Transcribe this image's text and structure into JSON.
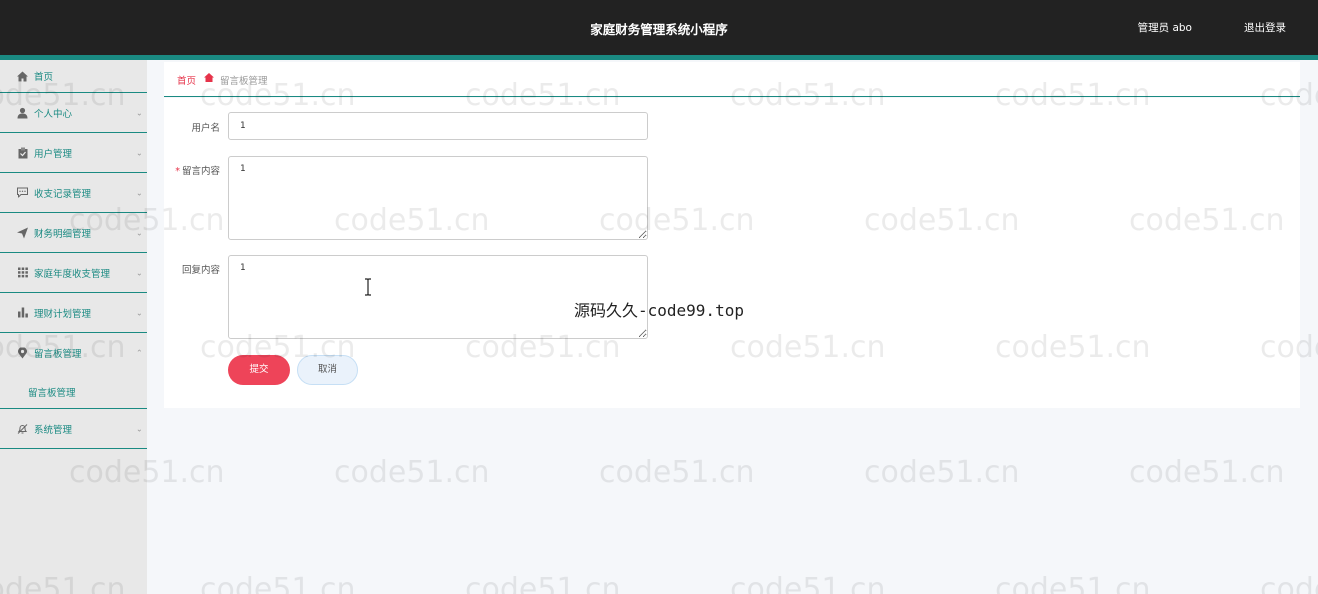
{
  "header": {
    "title": "家庭财务管理系统小程序",
    "user": "管理员 abo",
    "logout": "退出登录"
  },
  "sidebar": {
    "items": [
      {
        "label": "首页",
        "icon": "home-icon"
      },
      {
        "label": "个人中心",
        "icon": "user-icon"
      },
      {
        "label": "用户管理",
        "icon": "clipboard-icon"
      },
      {
        "label": "收支记录管理",
        "icon": "comment-icon"
      },
      {
        "label": "财务明细管理",
        "icon": "send-icon"
      },
      {
        "label": "家庭年度收支管理",
        "icon": "grid-icon"
      },
      {
        "label": "理财计划管理",
        "icon": "bar-chart-icon"
      },
      {
        "label": "留言板管理",
        "icon": "location-icon"
      },
      {
        "label": "系统管理",
        "icon": "bell-off-icon"
      }
    ],
    "submenu_label": "留言板管理"
  },
  "breadcrumb": {
    "home": "首页",
    "current": "留言板管理"
  },
  "form": {
    "username_label": "用户名",
    "username_value": "1",
    "required_mark": "*",
    "message_label": "留言内容",
    "message_value": "1",
    "reply_label": "回复内容",
    "reply_value": "1",
    "submit": "提交",
    "cancel": "取消"
  },
  "watermark": {
    "text": "code51.cn",
    "overlay": "源码久久-code99.top"
  }
}
